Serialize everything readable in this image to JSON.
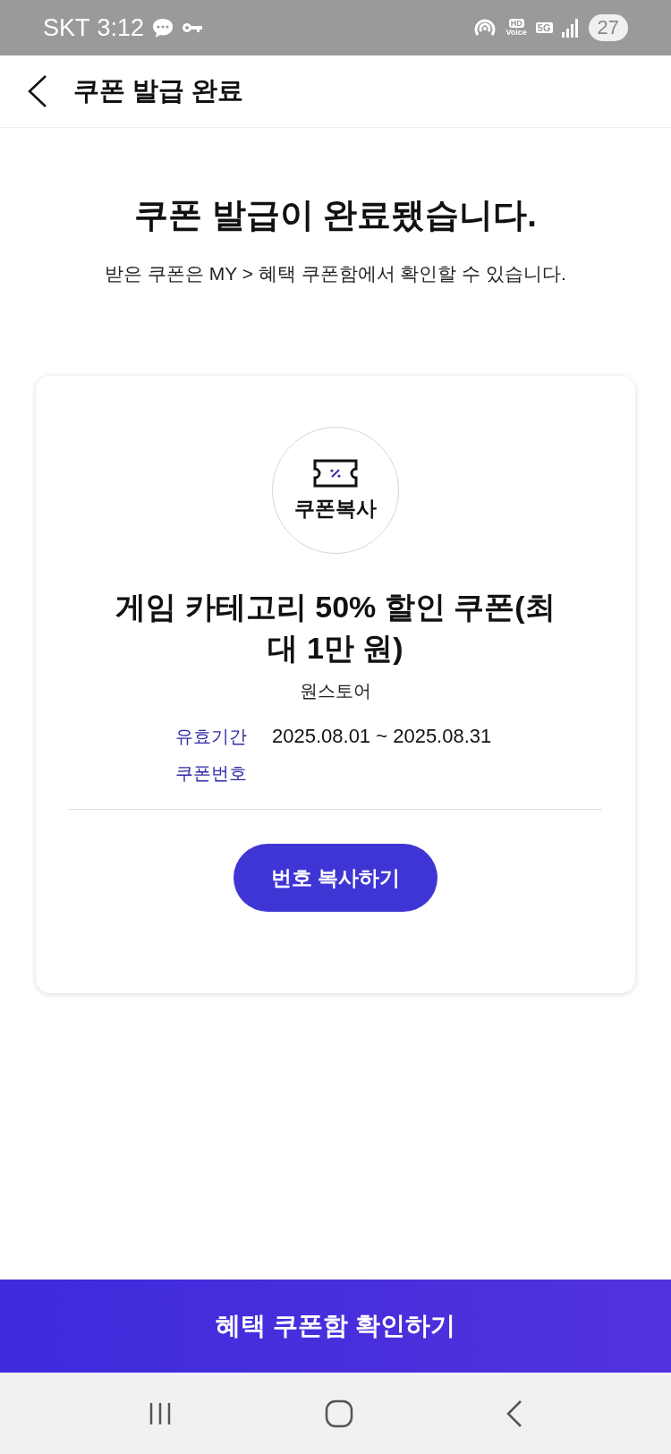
{
  "status_bar": {
    "carrier": "SKT",
    "time": "3:12",
    "hd_label": "HD",
    "voice_label": "Voice",
    "network": "5G",
    "battery": "27"
  },
  "header": {
    "title": "쿠폰 발급 완료"
  },
  "message": {
    "title": "쿠폰 발급이 완료됐습니다.",
    "subtitle": "받은 쿠폰은 MY > 혜택 쿠폰함에서 확인할 수 있습니다."
  },
  "coupon": {
    "copy_label": "쿠폰복사",
    "name": "게임 카테고리 50% 할인 쿠폰(최대 1만 원)",
    "store": "원스토어",
    "details": [
      {
        "label": "유효기간",
        "value": "2025.08.01 ~ 2025.08.31"
      },
      {
        "label": "쿠폰번호"
      }
    ],
    "copy_button": "번호 복사하기"
  },
  "bottom_button": "혜택 쿠폰함 확인하기"
}
